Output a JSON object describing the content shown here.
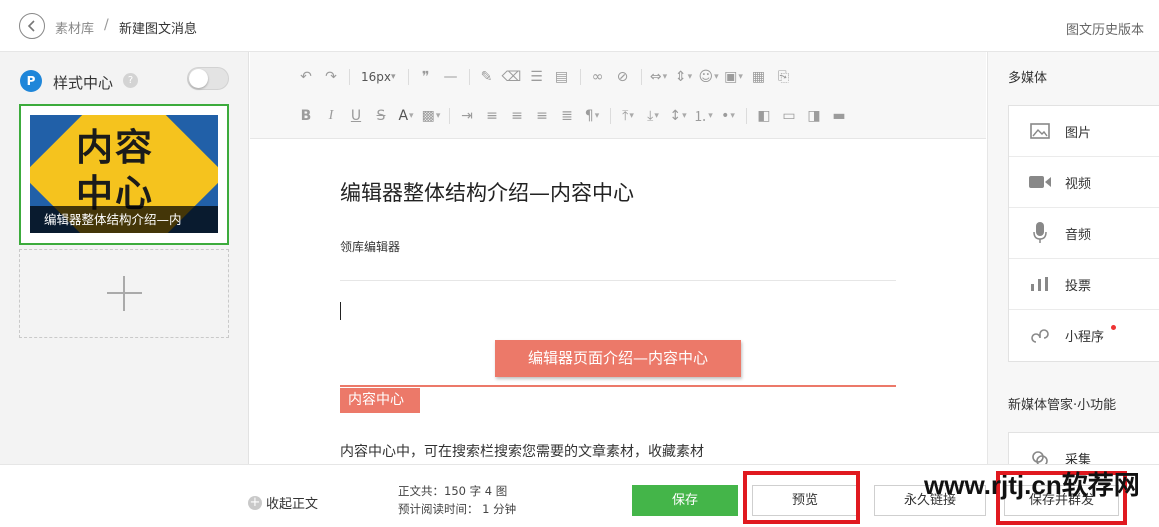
{
  "header": {
    "breadcrumb_root": "素材库",
    "breadcrumb_separator": "/",
    "breadcrumb_current": "新建图文消息",
    "history_link": "图文历史版本"
  },
  "left_panel": {
    "logo_letter": "P",
    "style_center_label": "样式中心",
    "help_glyph": "?",
    "toggle_on": false,
    "article": {
      "thumb_text_line1": "内容",
      "thumb_text_line2": "中心",
      "caption": "编辑器整体结构介绍—内"
    }
  },
  "toolbar": {
    "font_size": "16px"
  },
  "editor": {
    "title": "编辑器整体结构介绍—内容中心",
    "author": "领库编辑器",
    "section_button": "编辑器页面介绍—内容中心",
    "section_tag": "内容中心",
    "paragraph": "内容中心中，可在搜索栏搜索您需要的文章素材，收藏素材"
  },
  "right_panel": {
    "media_heading": "多媒体",
    "media_items": [
      {
        "label": "图片",
        "icon": "image-icon"
      },
      {
        "label": "视频",
        "icon": "video-icon"
      },
      {
        "label": "音频",
        "icon": "microphone-icon"
      },
      {
        "label": "投票",
        "icon": "poll-bars-icon"
      },
      {
        "label": "小程序",
        "icon": "mini-program-icon",
        "badge": true
      }
    ],
    "tools_heading": "新媒体管家·小功能",
    "tools_items": [
      {
        "label": "采集",
        "icon": "collect-icon"
      }
    ]
  },
  "footer": {
    "collapse_label": "收起正文",
    "stats_line1": "正文共：150 字 4 图",
    "stats_line2": "预计阅读时间： 1 分钟",
    "save_label": "保存",
    "preview_label": "预览",
    "permalink_label": "永久链接",
    "save_send_label": "保存并群发"
  },
  "watermark": "www.rjtj.cn软荐网",
  "colors": {
    "accent_green": "#44b549",
    "brand_salmon": "#ec7969",
    "highlight_red": "#e0191f",
    "selected_border": "#3cab3c"
  }
}
